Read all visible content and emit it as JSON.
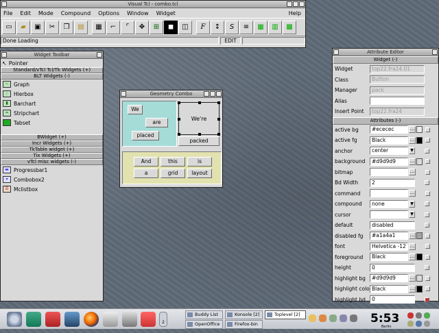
{
  "main_window": {
    "title": "Visual Tcl - combo.tcl",
    "menu": [
      "File",
      "Edit",
      "Mode",
      "Compound",
      "Options",
      "Window",
      "Widget"
    ],
    "help": "Help",
    "status": "Done Loading",
    "mode": "EDIT",
    "toolbar_icons": [
      "new-icon",
      "open-icon",
      "save-icon",
      "cut-icon",
      "copy-icon",
      "paste-icon",
      "toplevel-icon",
      "place-icon",
      "grid-icon",
      "move-icon",
      "select-icon",
      "raise-icon",
      "lower-icon",
      "font-icon",
      "vertical-align-icon",
      "sort-icon",
      "justify-icon",
      "table-icon",
      "grid-layout-icon",
      "grid-highlight-icon"
    ]
  },
  "widget_toolbar": {
    "title": "Widget Toolbar",
    "pointer": "Pointer",
    "categories": {
      "standard": "Standard/vTcl Tcl/Tk Widgets (+)",
      "blt": "BLT Widgets (-)",
      "bwidget": "BWidget (+)",
      "incr": "Incr Widgets (+)",
      "tktable": "TkTable widget (+)",
      "tix": "Tix Widgets (+)",
      "vtcl_misc": "vTcl misc widgets (-)"
    },
    "blt_items": [
      "Graph",
      "Hierbox",
      "Barchart",
      "Stripchart",
      "Tabset"
    ],
    "misc_items": [
      "Progressbar1",
      "Combobox2",
      "Mclistbox"
    ]
  },
  "geometry_combo": {
    "title": "Geometry Combo",
    "placed_buttons": [
      "We",
      "are",
      "placed"
    ],
    "packed_label": "We're",
    "packed_button": "packed",
    "grid_buttons": [
      "And",
      "this",
      "is",
      "a",
      "grid",
      "layout"
    ]
  },
  "attribute_editor": {
    "title": "Attribute Editor",
    "widget_header": "Widget (-)",
    "widget_rows": [
      {
        "label": "Widget",
        "value": "top22.fra24.01"
      },
      {
        "label": "Class",
        "value": "Button"
      },
      {
        "label": "Manager",
        "value": "pack"
      },
      {
        "label": "Alias",
        "value": ""
      },
      {
        "label": "Insert Point",
        "value": "top22.fra24"
      }
    ],
    "attributes_header": "Attributes (-)",
    "attr_rows": [
      {
        "label": "active bg",
        "value": "#ececec",
        "swatch": "#ececec"
      },
      {
        "label": "active fg",
        "value": "Black",
        "swatch": "#000000"
      },
      {
        "label": "anchor",
        "value": "center"
      },
      {
        "label": "background",
        "value": "#d9d9d9",
        "swatch": "#d9d9d9"
      },
      {
        "label": "bitmap",
        "value": ""
      },
      {
        "label": "Bd Width",
        "value": "2"
      },
      {
        "label": "command",
        "value": ""
      },
      {
        "label": "compound",
        "value": "none"
      },
      {
        "label": "cursor",
        "value": ""
      },
      {
        "label": "default",
        "value": "disabled"
      },
      {
        "label": "disabled fg",
        "value": "#a1a4a1",
        "swatch": "#a1a4a1"
      },
      {
        "label": "font",
        "value": "Helvetica -12"
      },
      {
        "label": "foreground",
        "value": "Black",
        "swatch": "#000000"
      },
      {
        "label": "height",
        "value": "0"
      },
      {
        "label": "highlight bg",
        "value": "#d9d9d9",
        "swatch": "#d9d9d9"
      },
      {
        "label": "highlight color",
        "value": "Black",
        "swatch": "#000000"
      },
      {
        "label": "highlight bd",
        "value": "0"
      }
    ]
  },
  "taskbar": {
    "tasks": [
      "Buddy List",
      "Konsole [2]",
      "Toplevel [2]",
      "OpenOffice",
      "Firefox-bin"
    ],
    "clock": "5:53",
    "date": "Berlin",
    "workspace": "2"
  }
}
